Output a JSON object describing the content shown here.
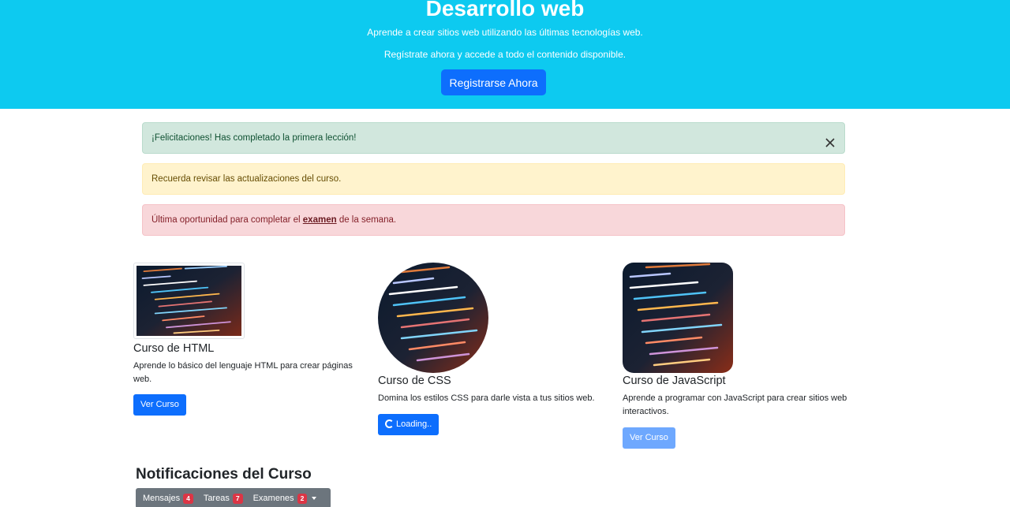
{
  "hero": {
    "title": "Desarrollo web",
    "lead_line1": "Aprende a crear sitios web utilizando las últimas tecnologías web.",
    "lead_line2": "Regístrate ahora y accede a todo el contenido disponible.",
    "register_button": "Registrarse Ahora"
  },
  "alerts": {
    "success": "¡Felicitaciones! Has completado la primera lección!",
    "warning": "Recuerda revisar las actualizaciones del curso.",
    "danger_prefix": "Última oportunidad para completar el ",
    "danger_link": "examen",
    "danger_suffix": " de la semana."
  },
  "cards": [
    {
      "title": "Curso de HTML",
      "text": "Aprende lo básico del lenguaje HTML para crear páginas web.",
      "button": "Ver Curso",
      "image_style": "thumbnail"
    },
    {
      "title": "Curso de CSS",
      "text": "Domina los estilos CSS para darle vista a tus sitios web.",
      "button": "Loading..",
      "image_style": "circle"
    },
    {
      "title": "Curso de JavaScript",
      "text": "Aprende a programar con JavaScript para crear sitios web interactivos.",
      "button": "Ver Curso",
      "image_style": "rounded",
      "button_state": "disabled"
    }
  ],
  "notifications": {
    "title": "Notificaciones del Curso",
    "items": [
      {
        "label": "Mensajes",
        "count": "4"
      },
      {
        "label": "Tareas",
        "count": "7"
      },
      {
        "label": "Examenes",
        "count": "2"
      }
    ]
  },
  "colors": {
    "hero_bg": "#0dcaf0",
    "primary": "#0d6efd",
    "success_bg": "#d1e7dd",
    "warning_bg": "#fff3cd",
    "danger_bg": "#f8d7da",
    "badge": "#dc3545",
    "notif_bar": "#6c757d"
  },
  "icons": {
    "close": "close-icon",
    "spinner": "spinner-icon",
    "dropdown": "chevron-down-icon"
  }
}
